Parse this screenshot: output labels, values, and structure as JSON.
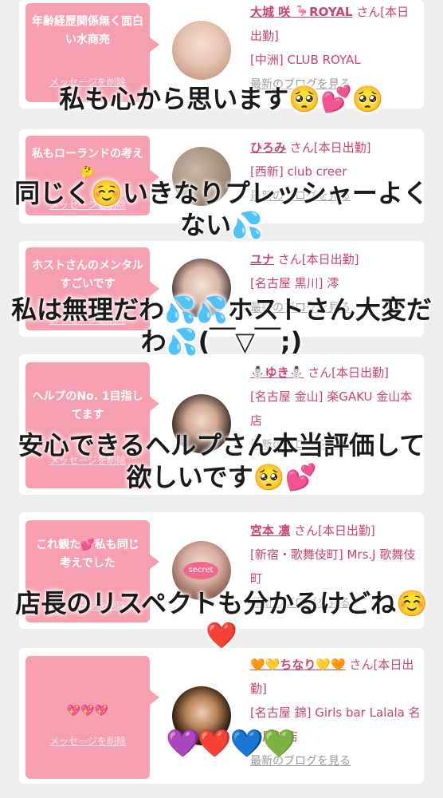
{
  "colors": {
    "accent": "#f59fb0",
    "name_link": "#c8456a"
  },
  "cards": [
    {
      "message": "年齢経歴関係無く面白い水商売",
      "delete_label": "メッセージを削除",
      "name": "大城 咲 🦩ROYAL",
      "suffix": " さん[本日出勤]",
      "shop": "[中洲] CLUB ROYAL",
      "blog": "最新のブログを見る"
    },
    {
      "message": "私もローランドの考え🤔",
      "delete_label": "メッセージを削除",
      "name": "ひろみ",
      "suffix": " さん[本日出勤]",
      "shop": "[西新] club creer",
      "blog": "最新のブログを見る"
    },
    {
      "message": "ホストさんのメンタルすごいです",
      "delete_label": "メッセージを削除",
      "name": "ユナ",
      "suffix": " さん[本日出勤]",
      "shop": "[名古屋 黒川] 澪",
      "blog": "最新のブログを見る"
    },
    {
      "message": "ヘルプのNo. 1目指してます",
      "delete_label": "メッセージを削除",
      "name": "⛄ゆき⛄",
      "suffix": " さん[本日出勤]",
      "shop": "[名古屋 金山] 楽GAKU 金山本店",
      "blog": "最新のブログを見る"
    },
    {
      "message": "これ観た💕私も同じ考えでした",
      "delete_label": "メッセージを削除",
      "name": "宮本 凛",
      "suffix": " さん[本日出勤]",
      "shop": "[新宿・歌舞伎町] Mrs.J 歌舞伎町",
      "blog": "最新のブログを見る",
      "badge": "secret"
    },
    {
      "message": "💖💖💖",
      "delete_label": "メッセージを削除",
      "name": "🧡💛ちなり💛🧡",
      "suffix": " さん[本日出勤]",
      "shop": "[名古屋 錦] Girls bar Lalala 名古屋錦店",
      "blog": "最新のブログを見る"
    }
  ],
  "overlays": [
    "私も心から思います🥺💕🥺",
    "同じく☺️いきなりプレッシャーよくない💦",
    "私は無理だわ💦💦ホストさん大変だわ💦(￣▽￣;)",
    "安心できるヘルプさん本当評価して欲しいです🥺💕",
    "店長のリスペクトも分かるけどね☺️❤️"
  ],
  "hearts": "💜❤️💙💚"
}
